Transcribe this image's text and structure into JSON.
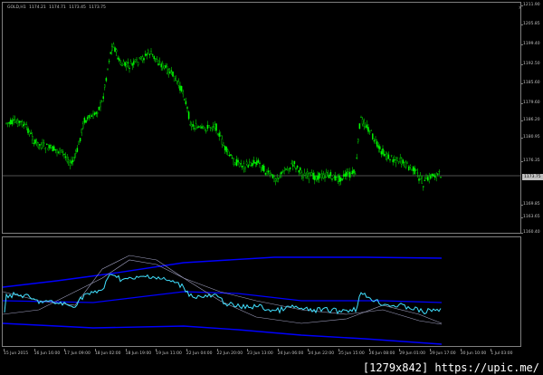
{
  "window": {
    "symbol_info": [
      "GOLD,H1",
      "1174.21",
      "1174.71",
      "1173.45",
      "1173.75"
    ],
    "close_label": "×"
  },
  "price_axis": {
    "ticks": [
      "1211.90",
      "1205.85",
      "1199.40",
      "1192.50",
      "1185.60",
      "1179.60",
      "1186.20",
      "1180.95",
      "1176.35",
      "1169.85",
      "1163.65",
      "1160.40"
    ],
    "current_price": "1173.75"
  },
  "indicator_axis": {
    "ticks": []
  },
  "time_axis": {
    "labels": [
      "15 Jun 2015",
      "16 Jun 16:00",
      "17 Jun 09:00",
      "18 Jun 02:00",
      "18 Jun 19:00",
      "19 Jun 11:00",
      "22 Jun 04:00",
      "22 Jun 20:00",
      "23 Jun 13:00",
      "24 Jun 06:00",
      "24 Jun 22:00",
      "25 Jun 15:00",
      "26 Jun 08:00",
      "29 Jun 01:00",
      "29 Jun 17:00",
      "30 Jun 10:00",
      "1 Jul 03:00"
    ]
  },
  "watermark": "[1279x842] https://upic.me/",
  "colors": {
    "background": "#000000",
    "bull": "#00ff00",
    "bear": "#00ff00",
    "indicator_main": "#40e0ff",
    "indicator_band": "#0000ff",
    "envelope": "#a0a0c0",
    "grid": "#7f7f7f",
    "text": "#c0c0c0"
  }
}
